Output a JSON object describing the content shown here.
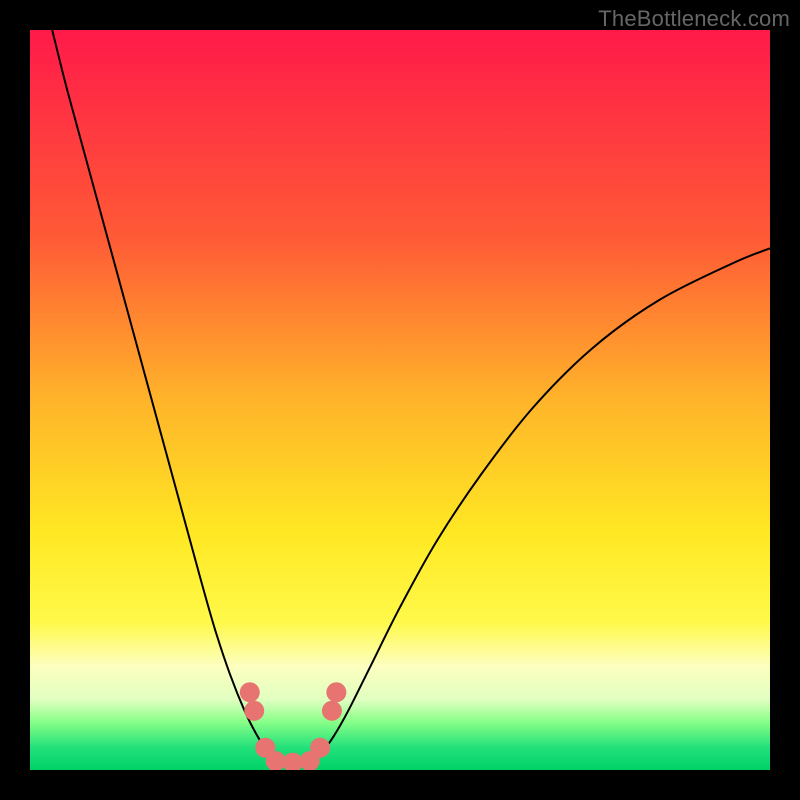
{
  "watermark": "TheBottleneck.com",
  "chart_data": {
    "type": "line",
    "title": "",
    "xlabel": "",
    "ylabel": "",
    "xlim": [
      0,
      100
    ],
    "ylim": [
      0,
      100
    ],
    "background_gradient": {
      "stops": [
        {
          "offset": 0.0,
          "color": "#ff1a49"
        },
        {
          "offset": 0.28,
          "color": "#ff5a36"
        },
        {
          "offset": 0.5,
          "color": "#ffb42a"
        },
        {
          "offset": 0.68,
          "color": "#ffe823"
        },
        {
          "offset": 0.8,
          "color": "#fff94a"
        },
        {
          "offset": 0.86,
          "color": "#fdffc0"
        },
        {
          "offset": 0.905,
          "color": "#e0ffc0"
        },
        {
          "offset": 0.935,
          "color": "#88ff88"
        },
        {
          "offset": 0.97,
          "color": "#22e07a"
        },
        {
          "offset": 1.0,
          "color": "#00d268"
        }
      ]
    },
    "series": [
      {
        "name": "left-branch",
        "color": "#000000",
        "width": 2,
        "x": [
          3.0,
          5.0,
          8.0,
          11.0,
          14.0,
          17.0,
          20.0,
          23.0,
          25.0,
          27.0,
          29.0,
          30.5,
          32.0,
          33.0
        ],
        "y": [
          100,
          92,
          81,
          70,
          59,
          48,
          37,
          26,
          19,
          13,
          8,
          5,
          2.5,
          1.2
        ]
      },
      {
        "name": "right-branch",
        "color": "#000000",
        "width": 2,
        "x": [
          38.0,
          39.5,
          41.0,
          43.0,
          46.0,
          50.0,
          55.0,
          61.0,
          68.0,
          76.0,
          85.0,
          95.0,
          100.0
        ],
        "y": [
          1.2,
          2.5,
          4.5,
          8,
          14,
          22,
          31,
          40,
          49,
          57,
          63.5,
          68.5,
          70.5
        ]
      },
      {
        "name": "well-markers",
        "type": "scatter",
        "color": "#e77471",
        "radius": 10,
        "x": [
          29.7,
          30.3,
          31.8,
          33.2,
          35.5,
          37.8,
          39.2,
          40.8,
          41.4
        ],
        "y": [
          10.5,
          8.0,
          3.0,
          1.2,
          1.0,
          1.2,
          3.0,
          8.0,
          10.5
        ]
      }
    ]
  }
}
